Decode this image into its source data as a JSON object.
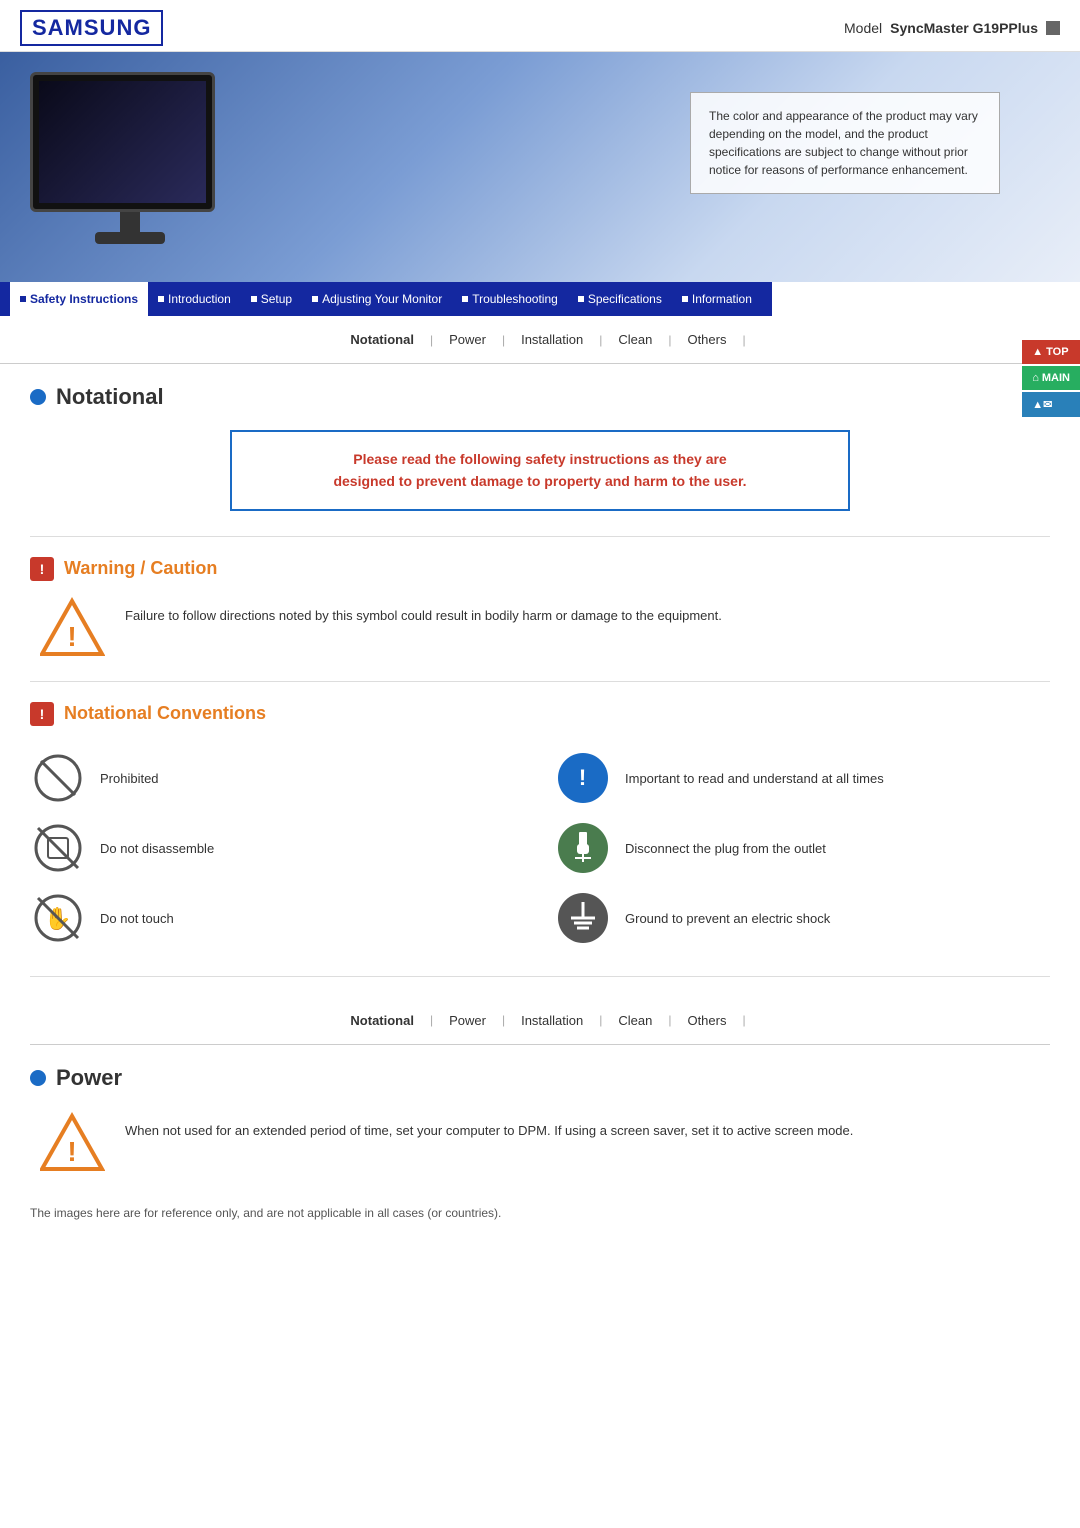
{
  "header": {
    "logo": "SAMSUNG",
    "model_label": "Model",
    "model_name": "SyncMaster G19PPlus"
  },
  "hero": {
    "disclaimer": "The color and appearance of the product may vary depending on the model, and the product specifications are subject to change without prior notice for reasons of performance enhancement."
  },
  "nav": {
    "items": [
      {
        "id": "safety",
        "label": "Safety Instructions",
        "active": true
      },
      {
        "id": "intro",
        "label": "Introduction",
        "active": false
      },
      {
        "id": "setup",
        "label": "Setup",
        "active": false
      },
      {
        "id": "adjust",
        "label": "Adjusting Your Monitor",
        "active": false
      },
      {
        "id": "trouble",
        "label": "Troubleshooting",
        "active": false
      },
      {
        "id": "specs",
        "label": "Specifications",
        "active": false
      },
      {
        "id": "info",
        "label": "Information",
        "active": false
      }
    ]
  },
  "side_buttons": [
    {
      "id": "top",
      "label": "TOP",
      "color": "red"
    },
    {
      "id": "main",
      "label": "MAIN",
      "color": "green"
    },
    {
      "id": "email",
      "label": "",
      "color": "blue"
    }
  ],
  "tabs": {
    "items": [
      {
        "id": "notational",
        "label": "Notational",
        "active": true
      },
      {
        "id": "power",
        "label": "Power",
        "active": false
      },
      {
        "id": "installation",
        "label": "Installation",
        "active": false
      },
      {
        "id": "clean",
        "label": "Clean",
        "active": false
      },
      {
        "id": "others",
        "label": "Others",
        "active": false
      }
    ],
    "separator": "|"
  },
  "sections": {
    "notational": {
      "title": "Notational",
      "safety_notice_line1": "Please read the following safety instructions as they are",
      "safety_notice_line2": "designed to prevent damage to property and harm to the user."
    },
    "warning_caution": {
      "title": "Warning / Caution",
      "description": "Failure to follow directions noted by this symbol could result in bodily harm or damage to the equipment."
    },
    "conventions": {
      "title": "Notational Conventions",
      "items": [
        {
          "id": "prohibited",
          "icon": "prohibited-icon",
          "label": "Prohibited"
        },
        {
          "id": "important",
          "icon": "info-icon",
          "label": "Important to read and understand at all times"
        },
        {
          "id": "disassemble",
          "icon": "disassemble-icon",
          "label": "Do not disassemble"
        },
        {
          "id": "disconnect",
          "icon": "plug-icon",
          "label": "Disconnect the plug from the outlet"
        },
        {
          "id": "notouch",
          "icon": "notouch-icon",
          "label": "Do not touch"
        },
        {
          "id": "ground",
          "icon": "ground-icon",
          "label": "Ground to prevent an electric shock"
        }
      ]
    },
    "power": {
      "title": "Power",
      "description": "When not used for an extended period of time, set your computer to DPM. If using a screen saver, set it to active screen mode."
    },
    "footer_note": "The images here are for reference only, and are not applicable in all cases (or countries)."
  }
}
